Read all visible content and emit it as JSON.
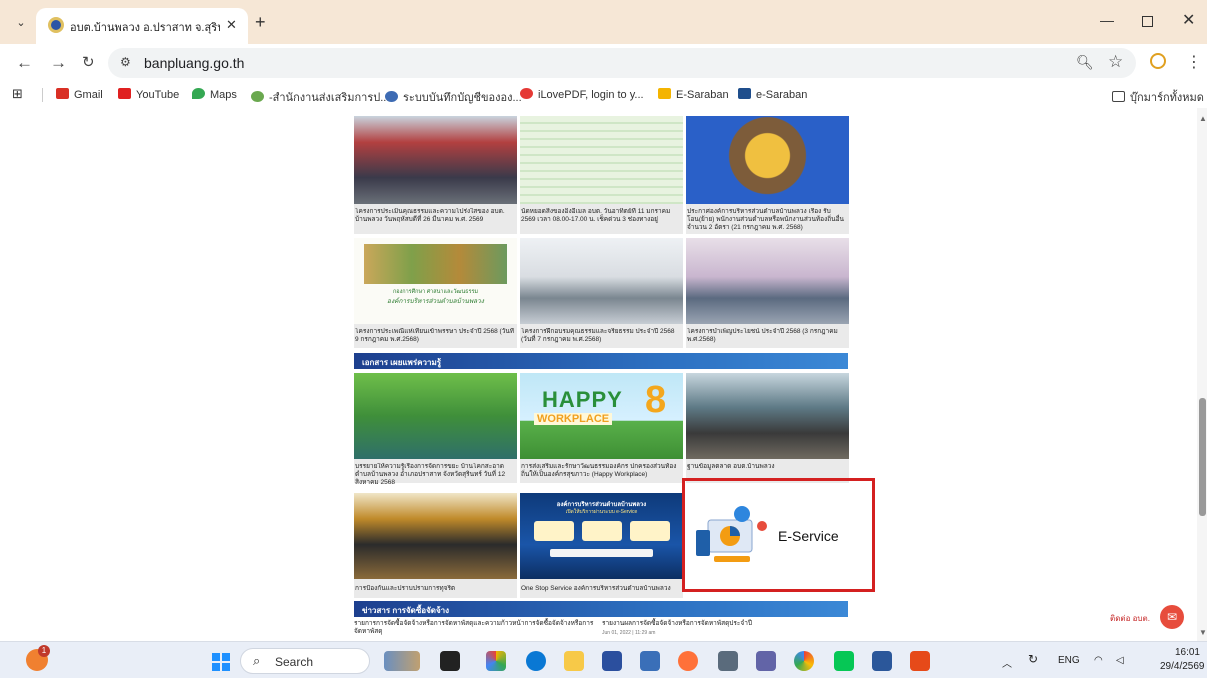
{
  "browser": {
    "tab_title": "อบต.บ้านพลวง อ.ปราสาท จ.สุรินทร์",
    "url": "banpluang.go.th",
    "bookmarks": [
      {
        "label": "Gmail",
        "icon": "gmail-icon",
        "color": "#d93025"
      },
      {
        "label": "YouTube",
        "icon": "youtube-icon",
        "color": "#e02020"
      },
      {
        "label": "Maps",
        "icon": "maps-icon",
        "color": "#34a853"
      },
      {
        "label": "-สำนักงานส่งเสริมการป...",
        "icon": "site-icon",
        "color": "#6aa84f"
      },
      {
        "label": "ระบบบันทึกบัญชีขององ...",
        "icon": "site-icon",
        "color": "#3d6bb3"
      },
      {
        "label": "iLovePDF, login to y...",
        "icon": "heart-icon",
        "color": "#e53935"
      },
      {
        "label": "E-Saraban",
        "icon": "esaraban-icon",
        "color": "#f4b400"
      },
      {
        "label": "e-Saraban",
        "icon": "calendar-icon",
        "color": "#1f4e8c"
      }
    ],
    "all_bookmarks_label": "บุ๊กมาร์กทั้งหมด"
  },
  "page": {
    "cards_row1": [
      {
        "caption": "โครงการประเมินคุณธรรมและความโปร่งใสของ อบต. บ้านพลวง วันพฤหัสบดีที่ 26 มีนาคม พ.ศ. 2569"
      },
      {
        "caption": "นัดหยอดสิ่งของอิงอีเมล อบต. วันอาทิตย์ที่ 11 มกราคม 2569 เวลา 08.00-17.00 น. เช็คด่วน 3 ช่องทางอยู่"
      },
      {
        "caption": "ประกาศองค์การบริหารส่วนตำบลบ้านพลวง เรื่อง รับโอน(ย้าย) พนักงานส่วนตำบลหรือพนักงานส่วนท้องถิ่นอื่น จำนวน 2 อัตรา (21 กรกฎาคม พ.ศ. 2568)"
      }
    ],
    "cards_row2": [
      {
        "caption": "โครงการประเพณีแห่เทียนเข้าพรรษา ประจำปี 2568 (วันที่ 9 กรกฎาคม พ.ศ.2568)",
        "banner1": "กองการศึกษา ศาสนาและวัฒนธรรม",
        "banner2": "องค์การบริหารส่วนตำบลบ้านพลวง"
      },
      {
        "caption": "โครงการฝึกอบรมคุณธรรมและจริยธรรม ประจำปี 2568 (วันที่ 7 กรกฎาคม พ.ศ.2568)"
      },
      {
        "caption": "โครงการบำเพ็ญประโยชน์ ประจำปี 2568 (3 กรกฎาคม พ.ศ.2568)"
      }
    ],
    "section_documents": "เอกสาร เผยแพร่ความรู้",
    "cards_row3": [
      {
        "caption": "บรรยายให้ความรู้เรื่องการจัดการขยะ บ้านโคกสะอาด ตำบลบ้านพลวง อำเภอปราสาท จังหวัดสุรินทร์ วันที่ 12 สิงหาคม 2568"
      },
      {
        "caption": "การส่งเสริมและรักษาวัฒนธรรมองค์กร ปกครองส่วนท้องถิ่นให้เป็นองค์กรสุขภาวะ (Happy Workplace)",
        "happy_line1": "HAPPY",
        "happy_line2": "WORKPLACE",
        "happy_number": "8"
      },
      {
        "caption": "ฐานข้อมูลตลาด อบต.บ้านพลวง"
      }
    ],
    "cards_row4": [
      {
        "caption": "การป้องกันและปราบปรามการทุจริต"
      },
      {
        "caption": "One Stop Service องค์การบริหารส่วนตำบลบ้านพลวง",
        "poster_title": "องค์การบริหารส่วนตำบลบ้านพลวง",
        "poster_subtitle": "เปิดให้บริการผ่านระบบ e-Service"
      },
      {
        "caption": "",
        "eservice_label": "E-Service"
      }
    ],
    "section_news": "ข่าวสาร การจัดซื้อจัดจ้าง",
    "news_items": [
      "รายการการจัดซื้อจัดจ้างหรือการจัดหาพัสดุและความก้าวหน้าการจัดซื้อจัดจ้างหรือการจัดหาพัสดุ",
      "รายงานผลการจัดซื้อจัดจ้างหรือการจัดหาพัสดุประจำปี"
    ],
    "news_date": "Jun 01, 2022 | 11:29 am",
    "chat_label": "ติดต่อ อบต."
  },
  "taskbar": {
    "search_label": "Search",
    "notification_badge": "1",
    "language": "ENG",
    "time": "16:01",
    "date": "29/4/2569"
  },
  "colors": {
    "highlight_border": "#d42020",
    "section_bar": "#1d3f8e",
    "chrome_tabstrip": "#f6e7d6"
  }
}
